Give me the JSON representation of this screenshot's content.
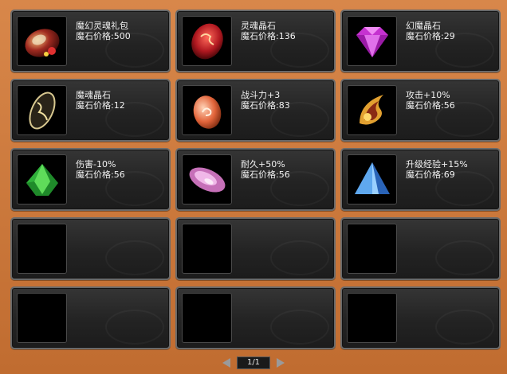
{
  "items": [
    {
      "name": "魔幻灵魂礼包",
      "price": "魔石价格:500",
      "icon": "gift-bag-icon",
      "color": "#b8342a"
    },
    {
      "name": "灵魂晶石",
      "price": "魔石价格:136",
      "icon": "red-soul-crystal-icon",
      "color": "#c0262a"
    },
    {
      "name": "幻魔晶石",
      "price": "魔石价格:29",
      "icon": "purple-diamond-icon",
      "color": "#d54ad9"
    },
    {
      "name": "魔魂晶石",
      "price": "魔石价格:12",
      "icon": "dark-rune-stone-icon",
      "color": "#3a3a2a"
    },
    {
      "name": "战斗力+3",
      "price": "魔石价格:83",
      "icon": "orange-swirl-stone-icon",
      "color": "#e87a55"
    },
    {
      "name": "攻击+10%",
      "price": "魔石价格:56",
      "icon": "gold-flame-amulet-icon",
      "color": "#e09a2a"
    },
    {
      "name": "伤害-10%",
      "price": "魔石价格:56",
      "icon": "green-gem-icon",
      "color": "#2ea83a"
    },
    {
      "name": "耐久+50%",
      "price": "魔石价格:56",
      "icon": "pink-crystal-icon",
      "color": "#d887c9"
    },
    {
      "name": "升级经验+15%",
      "price": "魔石价格:69",
      "icon": "blue-pyramid-crystal-icon",
      "color": "#3f86d8"
    },
    {
      "name": "",
      "price": "",
      "icon": "",
      "color": ""
    },
    {
      "name": "",
      "price": "",
      "icon": "",
      "color": ""
    },
    {
      "name": "",
      "price": "",
      "icon": "",
      "color": ""
    },
    {
      "name": "",
      "price": "",
      "icon": "",
      "color": ""
    },
    {
      "name": "",
      "price": "",
      "icon": "",
      "color": ""
    },
    {
      "name": "",
      "price": "",
      "icon": "",
      "color": ""
    }
  ],
  "pagination": {
    "label": "1/1"
  }
}
